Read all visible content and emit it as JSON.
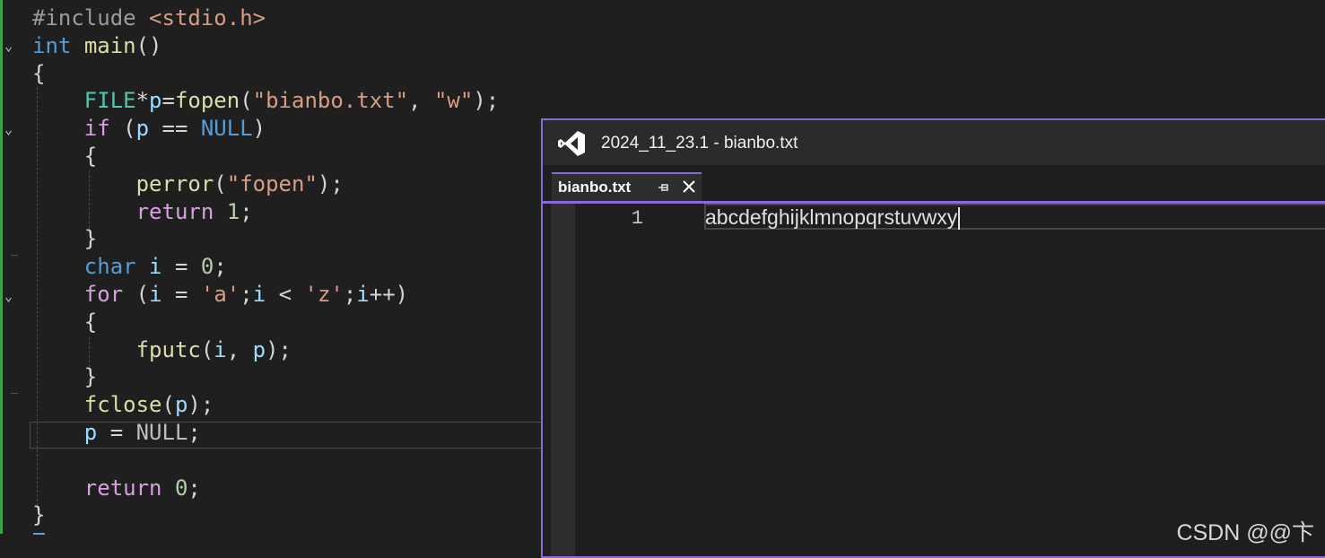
{
  "editor": {
    "lines": [
      [
        {
          "t": "#include ",
          "c": "pre"
        },
        {
          "t": "<stdio.h>",
          "c": "str"
        }
      ],
      [
        {
          "t": "int",
          "c": "kw"
        },
        {
          "t": " ",
          "c": "punc"
        },
        {
          "t": "main",
          "c": "fn"
        },
        {
          "t": "()",
          "c": "punc"
        }
      ],
      [
        {
          "t": "{",
          "c": "punc"
        }
      ],
      [
        {
          "t": "    ",
          "c": "punc"
        },
        {
          "t": "FILE",
          "c": "type"
        },
        {
          "t": "*",
          "c": "punc"
        },
        {
          "t": "p",
          "c": "var"
        },
        {
          "t": "=",
          "c": "punc"
        },
        {
          "t": "fopen",
          "c": "fn"
        },
        {
          "t": "(",
          "c": "punc"
        },
        {
          "t": "\"bianbo.txt\"",
          "c": "str"
        },
        {
          "t": ", ",
          "c": "punc"
        },
        {
          "t": "\"w\"",
          "c": "str"
        },
        {
          "t": ");",
          "c": "punc"
        }
      ],
      [
        {
          "t": "    ",
          "c": "punc"
        },
        {
          "t": "if",
          "c": "ctrl"
        },
        {
          "t": " (",
          "c": "punc"
        },
        {
          "t": "p",
          "c": "var"
        },
        {
          "t": " == ",
          "c": "punc"
        },
        {
          "t": "NULL",
          "c": "kw"
        },
        {
          "t": ")",
          "c": "punc"
        }
      ],
      [
        {
          "t": "    {",
          "c": "punc"
        }
      ],
      [
        {
          "t": "        ",
          "c": "punc"
        },
        {
          "t": "perror",
          "c": "fn"
        },
        {
          "t": "(",
          "c": "punc"
        },
        {
          "t": "\"fopen\"",
          "c": "str"
        },
        {
          "t": ");",
          "c": "punc"
        }
      ],
      [
        {
          "t": "        ",
          "c": "punc"
        },
        {
          "t": "return",
          "c": "ctrl"
        },
        {
          "t": " ",
          "c": "punc"
        },
        {
          "t": "1",
          "c": "num"
        },
        {
          "t": ";",
          "c": "punc"
        }
      ],
      [
        {
          "t": "    }",
          "c": "punc"
        }
      ],
      [
        {
          "t": "    ",
          "c": "punc"
        },
        {
          "t": "char",
          "c": "kw"
        },
        {
          "t": " ",
          "c": "punc"
        },
        {
          "t": "i",
          "c": "var"
        },
        {
          "t": " = ",
          "c": "punc"
        },
        {
          "t": "0",
          "c": "num"
        },
        {
          "t": ";",
          "c": "punc"
        }
      ],
      [
        {
          "t": "    ",
          "c": "punc"
        },
        {
          "t": "for",
          "c": "ctrl"
        },
        {
          "t": " (",
          "c": "punc"
        },
        {
          "t": "i",
          "c": "var"
        },
        {
          "t": " = ",
          "c": "punc"
        },
        {
          "t": "'a'",
          "c": "str"
        },
        {
          "t": ";",
          "c": "punc"
        },
        {
          "t": "i",
          "c": "var"
        },
        {
          "t": " < ",
          "c": "punc"
        },
        {
          "t": "'z'",
          "c": "str"
        },
        {
          "t": ";",
          "c": "punc"
        },
        {
          "t": "i",
          "c": "var"
        },
        {
          "t": "++)",
          "c": "punc"
        }
      ],
      [
        {
          "t": "    {",
          "c": "punc"
        }
      ],
      [
        {
          "t": "        ",
          "c": "punc"
        },
        {
          "t": "fputc",
          "c": "fn"
        },
        {
          "t": "(",
          "c": "punc"
        },
        {
          "t": "i",
          "c": "var"
        },
        {
          "t": ", ",
          "c": "punc"
        },
        {
          "t": "p",
          "c": "var"
        },
        {
          "t": ");",
          "c": "punc"
        }
      ],
      [
        {
          "t": "    }",
          "c": "punc"
        }
      ],
      [
        {
          "t": "    ",
          "c": "punc"
        },
        {
          "t": "fclose",
          "c": "fn"
        },
        {
          "t": "(",
          "c": "punc"
        },
        {
          "t": "p",
          "c": "var"
        },
        {
          "t": ");",
          "c": "punc"
        }
      ],
      [
        {
          "t": "    ",
          "c": "punc"
        },
        {
          "t": "p",
          "c": "var"
        },
        {
          "t": " = ",
          "c": "punc"
        },
        {
          "t": "NULL",
          "c": "null"
        },
        {
          "t": ";",
          "c": "punc"
        }
      ],
      [
        {
          "t": "",
          "c": "punc"
        }
      ],
      [
        {
          "t": "    ",
          "c": "punc"
        },
        {
          "t": "return",
          "c": "ctrl"
        },
        {
          "t": " ",
          "c": "punc"
        },
        {
          "t": "0",
          "c": "num"
        },
        {
          "t": ";",
          "c": "punc"
        }
      ],
      [
        {
          "t": "}",
          "c": "punc"
        }
      ]
    ]
  },
  "popup": {
    "title": "2024_11_23.1 - bianbo.txt",
    "tab_label": "bianbo.txt",
    "pin_icon": "pin-icon",
    "close_icon": "close-icon",
    "line_number": "1",
    "file_content": "abcdefghijklmnopqrstuvwxy"
  },
  "watermark": "CSDN @@卞",
  "colors": {
    "accent": "#8a6ad8",
    "change_bar": "#3fa14b"
  }
}
